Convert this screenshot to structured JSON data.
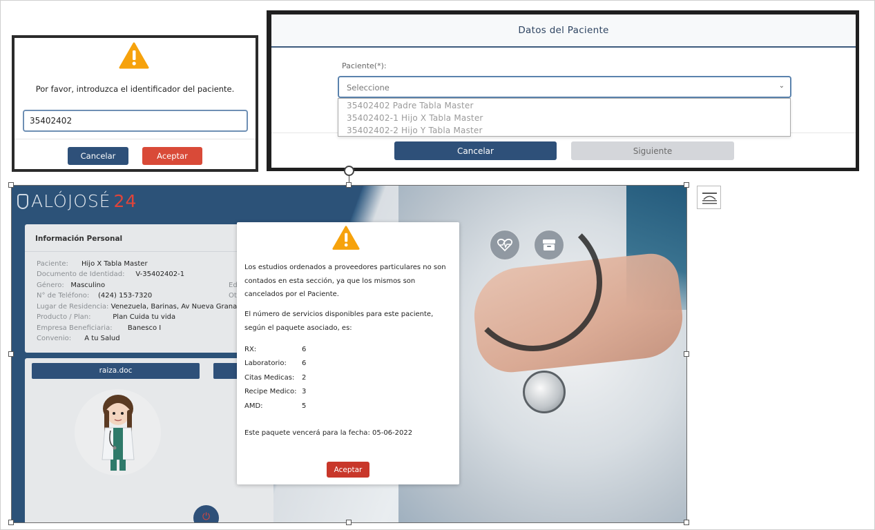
{
  "identifier_dialog": {
    "message": "Por favor, introduzca el identificador del paciente.",
    "input_value": "35402402",
    "cancel_label": "Cancelar",
    "accept_label": "Aceptar"
  },
  "patient_dialog": {
    "title": "Datos del Paciente",
    "field_label": "Paciente(*):",
    "select_value": "Seleccione",
    "options": [
      "35402402 Padre Tabla Master",
      "35402402-1 Hijo X Tabla Master",
      "35402402-2 Hijo Y Tabla Master"
    ],
    "cancel_label": "Cancelar",
    "next_label": "Siguiente"
  },
  "app": {
    "logo_part1": "ALÓJOSÉ",
    "logo_part2": "24",
    "personal_info": {
      "title": "Información Personal",
      "rows": [
        {
          "label": "Paciente:",
          "value": "Hijo X Tabla Master"
        },
        {
          "label": "Documento de Identidad:",
          "value": "V-35402402-1"
        },
        {
          "label": "Género:",
          "value": "Masculino"
        },
        {
          "label": "N° de Teléfono:",
          "value": "(424) 153-7320"
        },
        {
          "label": "Lugar de Residencia:",
          "value": "Venezuela, Barinas, Av Nueva Grana"
        },
        {
          "label": "Producto / Plan:",
          "value": "Plan Cuida tu vida"
        },
        {
          "label": "Empresa Beneficiaria:",
          "value": "Banesco I"
        },
        {
          "label": "Convenio:",
          "value": "A tu Salud"
        }
      ],
      "side_labels": [
        "Edad:",
        "Otro T"
      ]
    },
    "doc_tab": "raiza.doc"
  },
  "services_modal": {
    "paragraph1": [
      "Los estudios ordenados a proveedores particulares no son",
      "contados en esta sección, ya que los mismos son",
      "cancelados por el Paciente."
    ],
    "paragraph2": [
      "El número de servicios disponibles para este paciente,",
      "según el paquete asociado, es:"
    ],
    "services": [
      {
        "name": "RX:",
        "count": "6"
      },
      {
        "name": "Laboratorio:",
        "count": "6"
      },
      {
        "name": "Citas Medicas:",
        "count": "2"
      },
      {
        "name": "Recipe Medico:",
        "count": "3"
      },
      {
        "name": "AMD:",
        "count": "5"
      }
    ],
    "expiry": "Este paquete vencerá para la fecha: 05-06-2022",
    "accept_label": "Aceptar"
  },
  "colors": {
    "primary": "#2e5079",
    "danger": "#d94a38",
    "warning": "#f6a20c",
    "accent_red": "#e0443a"
  },
  "icons": [
    "warning-icon",
    "heartbeat-icon",
    "inbox-icon",
    "power-icon",
    "chevron-down-icon",
    "wrap-text-icon"
  ]
}
